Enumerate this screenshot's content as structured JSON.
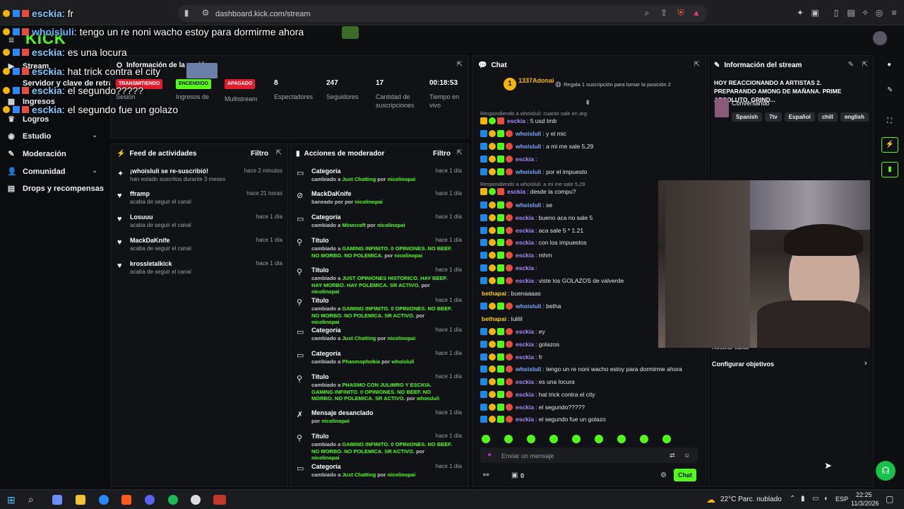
{
  "browser": {
    "url": "dashboard.kick.com/stream"
  },
  "overlay_chat": [
    {
      "user": "esckia",
      "text": ": fr"
    },
    {
      "user": "whoisluli",
      "text": ": tengo un re noni wacho estoy para dormirme ahora"
    },
    {
      "user": "esckia",
      "text": ": es una locura"
    },
    {
      "user": "esckia",
      "text": ": hat trick contra el city"
    },
    {
      "user": "esckia",
      "text": ": el segundo?????"
    },
    {
      "user": "esckia",
      "text": ": el segundo fue un golazo"
    }
  ],
  "logo": "KICK",
  "nav": {
    "items": [
      {
        "label": "Stream",
        "icon": "stream-icon"
      },
      {
        "label": "Servidor y clave de retransm",
        "icon": "key-icon"
      },
      {
        "label": "Ingresos",
        "icon": "money-icon"
      },
      {
        "label": "Logros",
        "icon": "trophy-icon"
      },
      {
        "label": "Estudio",
        "icon": "studio-icon"
      },
      {
        "label": "Moderación",
        "icon": "wrench-icon"
      },
      {
        "label": "Comunidad",
        "icon": "community-icon"
      },
      {
        "label": "Drops y recompensas",
        "icon": "gift-icon"
      }
    ]
  },
  "session": {
    "title": "Información de la sesión",
    "badges": {
      "live": "TRANSMITIENDO",
      "on": "ENCENDIDO",
      "off": "APAGADO"
    },
    "labels": {
      "session": "Sesión",
      "income": "Ingresos de",
      "multistream": "Multistream",
      "viewers": "Espectadores",
      "followers": "Seguidores",
      "subs": "Cantidad de suscripciones",
      "time": "Tiempo en vivo"
    },
    "values": {
      "viewers": "8",
      "followers": "247",
      "subs": "17",
      "time": "00:18:53"
    }
  },
  "feed": {
    "title": "Feed de actividades",
    "filter": "Filtro",
    "rows": [
      {
        "name": "¡whoisluli se re-suscribió!",
        "sub": "han estado suscritos durante 3 meses",
        "time": "hace 2 minutos",
        "icon": "star-icon"
      },
      {
        "name": "fframp",
        "sub": "acaba de seguir el canal",
        "time": "hace 21 horas",
        "icon": "heart-icon"
      },
      {
        "name": "Losuuu",
        "sub": "acaba de seguir el canal",
        "time": "hace 1 día",
        "icon": "heart-icon"
      },
      {
        "name": "MackDaKnife",
        "sub": "acaba de seguir el canal",
        "time": "hace 1 día",
        "icon": "heart-icon"
      },
      {
        "name": "krossletalkick",
        "sub": "acaba de seguir el canal",
        "time": "hace 1 día",
        "icon": "heart-icon"
      }
    ]
  },
  "mod": {
    "title": "Acciones de moderador",
    "filter": "Filtro",
    "rows": [
      {
        "title": "Categoría",
        "pre": "cambiado a ",
        "val": "Just Chatting",
        "by": "nicolinopai",
        "time": "hace 1 día",
        "icon": "category-icon"
      },
      {
        "title": "MackDaKnife",
        "pre": "baneado por ",
        "val": "",
        "by": "nicolinopai",
        "time": "hace 1 día",
        "icon": "ban-icon"
      },
      {
        "title": "Categoría",
        "pre": "cambiado a ",
        "val": "Minecraft",
        "by": "nicolinopai",
        "time": "hace 1 día",
        "icon": "category-icon"
      },
      {
        "title": "Título",
        "pre": "cambiado a ",
        "val": "GAMING INFINITO. 0 OPINIONES. NO BEEF. NO MORBO. NO POLEMICA.",
        "by": "nicolinopai",
        "time": "hace 1 día",
        "icon": "title-icon"
      },
      {
        "title": "Título",
        "pre": "cambiado a ",
        "val": "JUST OPINIONES HISTORICO. HAY BEEF. HAY MORBO. HAY POLEMICA. SR ACTIVO.",
        "by": "nicolinopai",
        "time": "hace 1 día",
        "icon": "title-icon"
      },
      {
        "title": "Título",
        "pre": "cambiado a ",
        "val": "GAMING INFINITO. 0 OPINIONES. NO BEEF. NO MORBO. NO POLEMICA. SR ACTIVO.",
        "by": "nicolinopai",
        "time": "hace 1 día",
        "icon": "title-icon"
      },
      {
        "title": "Categoría",
        "pre": "cambiado a ",
        "val": "Just Chatting",
        "by": "nicolinopai",
        "time": "hace 1 día",
        "icon": "category-icon"
      },
      {
        "title": "Categoría",
        "pre": "cambiado a ",
        "val": "Phasmophobia",
        "by": "whoisluli",
        "time": "hace 1 día",
        "icon": "category-icon"
      },
      {
        "title": "Título",
        "pre": "cambiado a ",
        "val": "PHASMO CON JULIMRG Y ESCKIA. GAMING INFINITO. 0 OPINIONES. NO BEEF. NO MORBO. NO POLEMICA. SR ACTIVO.",
        "by": "whoisluli",
        "time": "hace 1 día",
        "icon": "title-icon"
      },
      {
        "title": "Mensaje desanclado",
        "pre": "",
        "val": "",
        "by": "nicolinopai",
        "time": "hace 1 día",
        "icon": "unpin-icon"
      },
      {
        "title": "Título",
        "pre": "cambiado a ",
        "val": "GAMING INFINITO. 0 OPINIONES. NO BEEF. NO MORBO. NO POLEMICA. SR ACTIVO.",
        "by": "nicolinopai",
        "time": "hace 1 día",
        "icon": "title-icon"
      },
      {
        "title": "Categoría",
        "pre": "cambiado a ",
        "val": "Just Chatting",
        "by": "nicolinopai",
        "time": "hace 1 día",
        "icon": "category-icon"
      }
    ],
    "by_word": "por"
  },
  "chat": {
    "title": "Chat",
    "top_gifter": "1337Adonai",
    "top_gifter_count": "1",
    "gift_prompt": "Regala 1 suscripción para tomar la posición 2",
    "lines": [
      {
        "kind": "reply",
        "text": "Respondiendo a whoisluli: cuanto sale en arg"
      },
      {
        "user": "esckia",
        "color": "#a78bfa",
        "text": ": 5 usd tmb",
        "badges": 3
      },
      {
        "user": "whoisluli",
        "color": "#7aa7ff",
        "text": ": y el mic",
        "badges": 4
      },
      {
        "user": "whoisluli",
        "color": "#7aa7ff",
        "text": ": a mi me sale 5,29",
        "badges": 4
      },
      {
        "user": "esckia",
        "color": "#a78bfa",
        "text": ":",
        "badges": 4
      },
      {
        "user": "whoisluli",
        "color": "#7aa7ff",
        "text": ": por el impuesto",
        "badges": 4
      },
      {
        "kind": "reply",
        "text": "Respondiendo a whoisluli: a mi me sale 5,29"
      },
      {
        "user": "esckia",
        "color": "#a78bfa",
        "text": ": desde la compu?",
        "badges": 3
      },
      {
        "user": "whoisluli",
        "color": "#7aa7ff",
        "text": ": se",
        "badges": 4
      },
      {
        "user": "esckia",
        "color": "#a78bfa",
        "text": ": bueno aca no sale 5",
        "badges": 4
      },
      {
        "user": "esckia",
        "color": "#a78bfa",
        "text": ": aca sale 5 * 1.21",
        "badges": 4
      },
      {
        "user": "esckia",
        "color": "#a78bfa",
        "text": ": con los impuestos",
        "badges": 4
      },
      {
        "user": "esckia",
        "color": "#a78bfa",
        "text": ": mhm",
        "badges": 4
      },
      {
        "user": "esckia",
        "color": "#a78bfa",
        "text": ":",
        "badges": 4
      },
      {
        "user": "esckia",
        "color": "#a78bfa",
        "text": ": viste los GOLAZOS de valverde",
        "badges": 4
      },
      {
        "user": "bethapai",
        "color": "#facc15",
        "text": ": buenaaaas",
        "badges": 0
      },
      {
        "user": "whoisluli",
        "color": "#7aa7ff",
        "text": ": betha",
        "badges": 4
      },
      {
        "user": "bethapai",
        "color": "#facc15",
        "text": ":      lulilil",
        "badges": 0
      },
      {
        "user": "esckia",
        "color": "#a78bfa",
        "text": ": ey",
        "badges": 4
      },
      {
        "user": "esckia",
        "color": "#a78bfa",
        "text": ": golazos",
        "badges": 4
      },
      {
        "user": "esckia",
        "color": "#a78bfa",
        "text": ": fr",
        "badges": 4
      },
      {
        "user": "whoisluli",
        "color": "#7aa7ff",
        "text": ": tengo un re noni wacho estoy para dormirme ahora",
        "badges": 4
      },
      {
        "user": "esckia",
        "color": "#a78bfa",
        "text": ": es una locura",
        "badges": 4
      },
      {
        "user": "esckia",
        "color": "#a78bfa",
        "text": ": hat trick contra el city",
        "badges": 4
      },
      {
        "user": "esckia",
        "color": "#a78bfa",
        "text": ": el segundo?????",
        "badges": 4
      },
      {
        "user": "esckia",
        "color": "#a78bfa",
        "text": ": el segundo fue un golazo",
        "badges": 4
      }
    ],
    "input_placeholder": "Enviar un mensaje",
    "points": "0",
    "send_label": "Chat"
  },
  "stream_info": {
    "title": "Información del stream",
    "stream_title": "HOY REACCIONANDO A ARTISTAS 2. PREPARANDO AMONG DE MAÑANA. PRIME ABSOLUTO. GRIND...",
    "category": "Conversando",
    "tags": [
      "Spanish",
      "7tv",
      "Español",
      "chill",
      "english"
    ],
    "obscured_label": "Hostear canal",
    "goals": "Configurar objetivos"
  },
  "taskbar": {
    "weather": "22°C  Parc. nublado",
    "lang": "ESP",
    "time": "22:25",
    "date": "11/3/2026"
  },
  "colors": {
    "accent": "#53fc18",
    "live_badge": "#e11d2e",
    "panel_bg": "#111215"
  }
}
